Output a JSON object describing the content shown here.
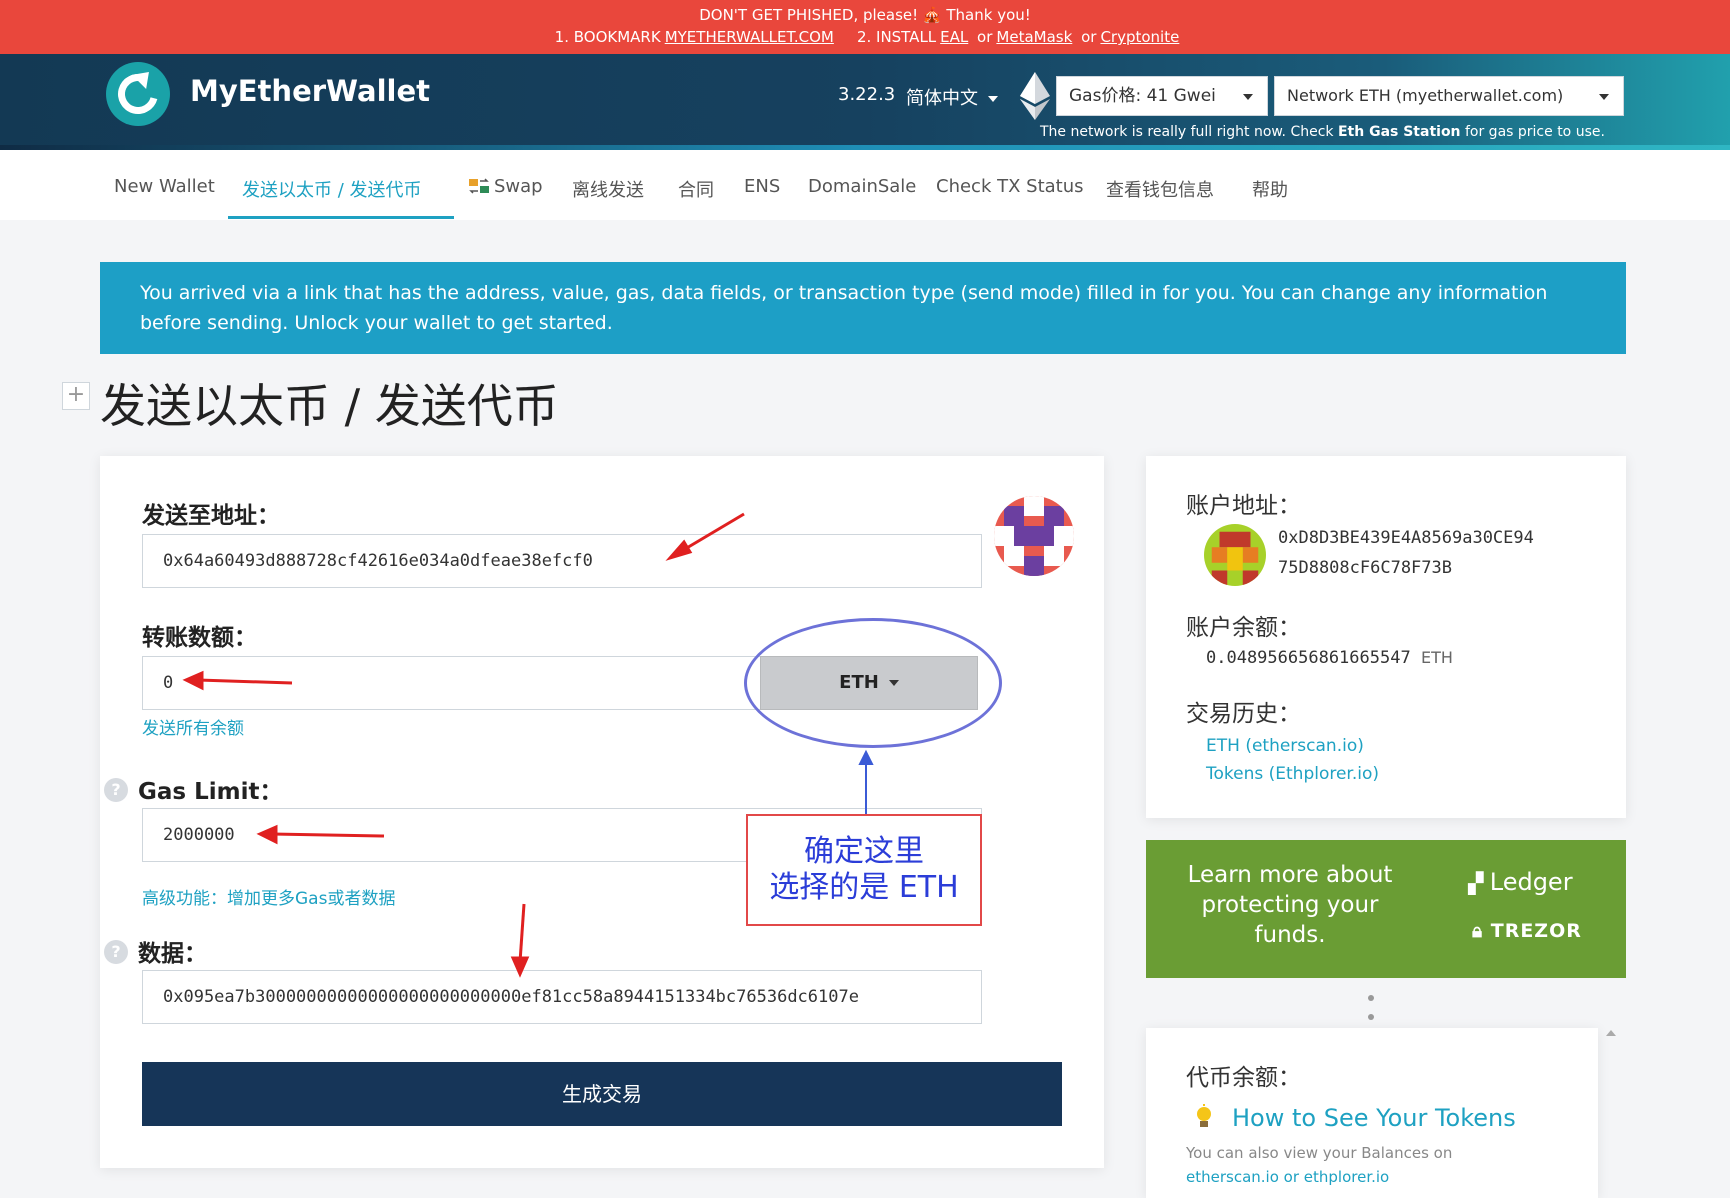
{
  "phishing": {
    "line1": "DON'T GET PHISHED, please! 🎪 Thank you!",
    "item1_prefix": "1. BOOKMARK",
    "item1_link": "MYETHERWALLET.COM",
    "item2_prefix": "2. INSTALL",
    "item2_link1": "EAL",
    "or1": "or",
    "item2_link2": "MetaMask",
    "or2": "or",
    "item2_link3": "Cryptonite"
  },
  "header": {
    "brand": "MyEtherWallet",
    "version": "3.22.3",
    "language": "简体中文",
    "gas_price": "Gas价格: 41 Gwei",
    "network": "Network ETH (myetherwallet.com)",
    "network_note_prefix": "The network is really full right now. Check",
    "network_note_link": "Eth Gas Station",
    "network_note_suffix": "for gas price to use."
  },
  "nav": {
    "items": [
      {
        "label": "New Wallet"
      },
      {
        "label": "发送以太币 / 发送代币"
      },
      {
        "label": "Swap"
      },
      {
        "label": "离线发送"
      },
      {
        "label": "合同"
      },
      {
        "label": "ENS"
      },
      {
        "label": "DomainSale"
      },
      {
        "label": "Check TX Status"
      },
      {
        "label": "查看钱包信息"
      },
      {
        "label": "帮助"
      }
    ]
  },
  "banner": {
    "text": "You arrived via a link that has the address, value, gas, data fields, or transaction type (send mode) filled in for you. You can change any information before sending. Unlock your wallet to get started."
  },
  "page": {
    "expand": "+",
    "title": "发送以太币 / 发送代币"
  },
  "form": {
    "to_label": "发送至地址：",
    "to_value": "0x64a60493d888728cf42616e034a0dfeae38efcf0",
    "amount_label": "转账数额：",
    "amount_value": "0",
    "currency": "ETH",
    "send_all": "发送所有余额",
    "gas_label": "Gas Limit：",
    "gas_value": "2000000",
    "advanced": "高级功能：增加更多Gas或者数据",
    "data_label": "数据：",
    "data_value": "0x095ea7b30000000000000000000000000ef81cc58a8944151334bc76536dc6107e",
    "generate": "生成交易",
    "help_mark": "?"
  },
  "annotation": {
    "line1": "确定这里",
    "line2": "选择的是 ETH"
  },
  "account": {
    "address_label": "账户地址：",
    "address_line1": "0xD8D3BE439E4A8569a30CE94",
    "address_line2": "75D8808cF6C78F73B",
    "balance_label": "账户余额：",
    "balance_value": "0.048956656861665547",
    "balance_unit": "ETH",
    "history_label": "交易历史：",
    "history_eth": "ETH (etherscan.io)",
    "history_tokens": "Tokens (Ethplorer.io)"
  },
  "promo": {
    "text": "Learn more about protecting your funds.",
    "ledger": "Ledger",
    "trezor": "TREZOR"
  },
  "tokens": {
    "label": "代币余额：",
    "how_to": "How to See Your Tokens",
    "note_line1": "You can also view your Balances on",
    "note_line2": "etherscan.io or ethplorer.io"
  },
  "colors": {
    "phish_red": "#e9473c",
    "header_navy": "#133954",
    "accent_teal": "#1ea1c2",
    "button_navy": "#163558",
    "promo_green": "#6a9d34",
    "annotation_red": "#e24848",
    "annotation_blue": "#2b3dd8"
  },
  "icons": [
    "mew-logo-icon",
    "ethereum-diamond-icon",
    "swap-icon",
    "help-icon",
    "identicon-icon",
    "ledger-icon",
    "trezor-lock-icon",
    "lightbulb-icon",
    "chevron-down-icon"
  ]
}
